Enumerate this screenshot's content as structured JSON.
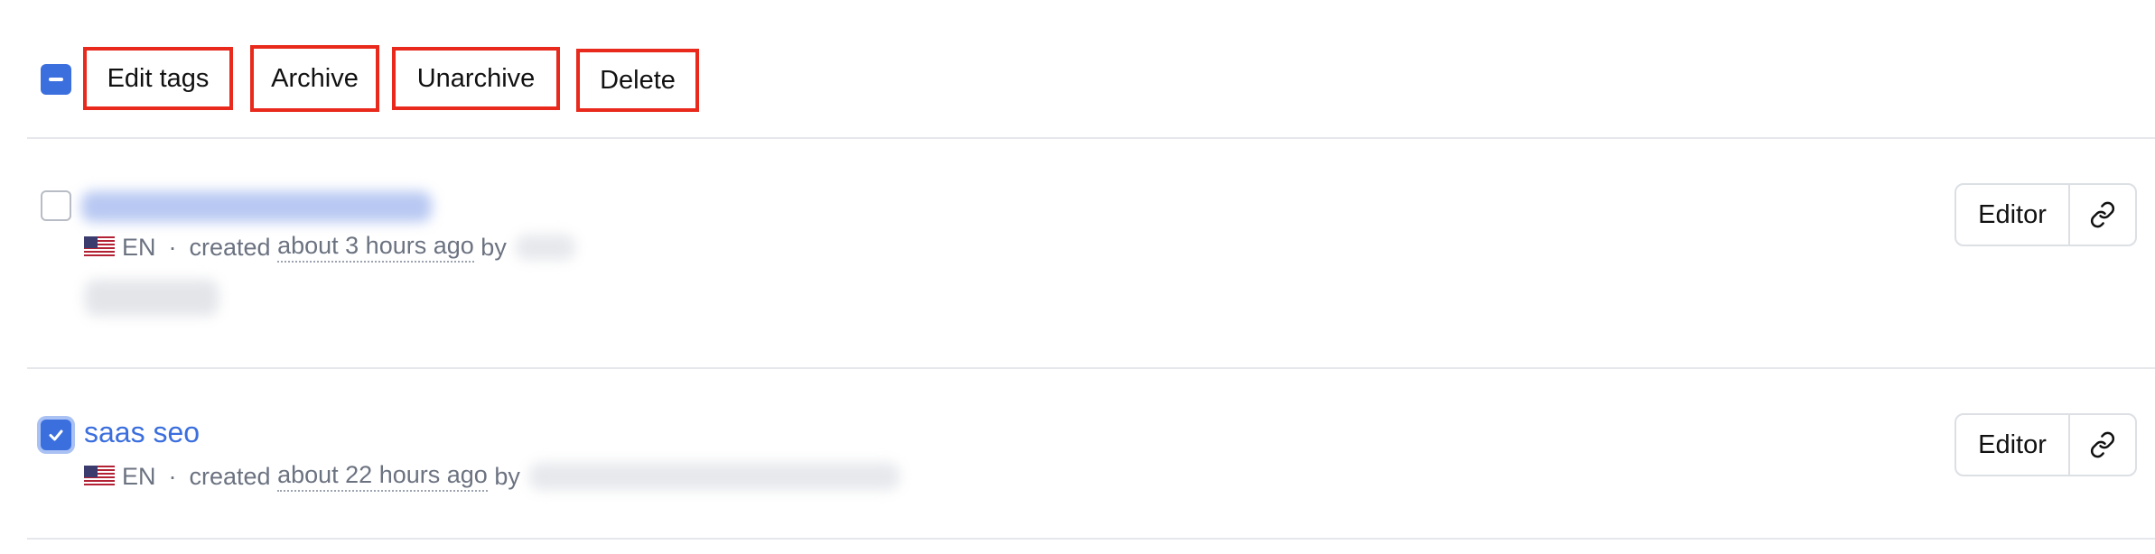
{
  "toolbar": {
    "edit_tags": "Edit tags",
    "archive": "Archive",
    "unarchive": "Unarchive",
    "delete": "Delete"
  },
  "rows": [
    {
      "checked": false,
      "language": "EN",
      "created_prefix": "created",
      "created_time": "about 3 hours ago",
      "by": "by",
      "editor_label": "Editor",
      "link_icon": "link-icon"
    },
    {
      "checked": true,
      "title": "saas seo",
      "language": "EN",
      "created_prefix": "created",
      "created_time": "about 22 hours ago",
      "by": "by",
      "editor_label": "Editor",
      "link_icon": "link-icon"
    }
  ],
  "colors": {
    "accent": "#3b6fde",
    "highlight_border": "#e8291c",
    "muted_text": "#6b7280"
  }
}
